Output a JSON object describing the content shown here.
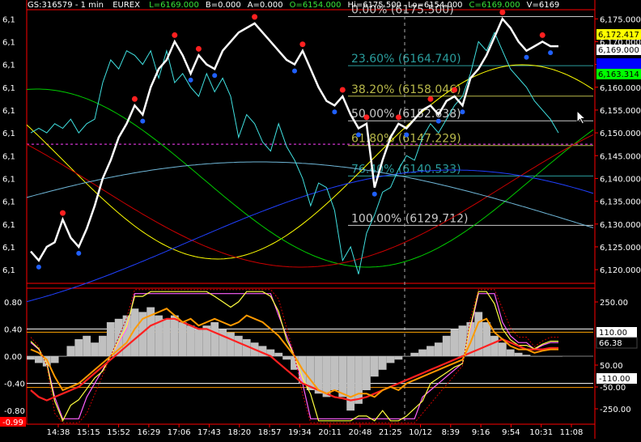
{
  "header": {
    "symbol": "GS:316579 - 1 min",
    "exchange": "EUREX",
    "fields": [
      {
        "text": "L=6169.000",
        "color": "#39e639"
      },
      {
        "text": "B=0.000",
        "color": "#ffffff"
      },
      {
        "text": "A=0.000",
        "color": "#ffffff"
      },
      {
        "text": "O=6154.000",
        "color": "#39e639"
      },
      {
        "text": "Hi=6175.500",
        "color": "#ffffff"
      },
      {
        "text": "Lo=6154.000",
        "color": "#ffffff"
      },
      {
        "text": "C=6169.000",
        "color": "#39e639"
      },
      {
        "text": "V=6169",
        "color": "#ffffff"
      }
    ]
  },
  "price_axis": {
    "ticks": [
      "6,175.000",
      "6,170.000",
      "6,165.000",
      "6,160.000",
      "6,155.000",
      "6,150.000",
      "6,145.000",
      "6,140.000",
      "6,135.000",
      "6,130.000",
      "6,125.000",
      "6,120.000"
    ],
    "left_ticks": [
      "6,1",
      "6,1",
      "6,1",
      "6,1",
      "6,1",
      "6,1",
      "6,1",
      "6,1",
      "6,1",
      "6,1",
      "6,1",
      "6,1"
    ],
    "markers": [
      {
        "text": "6,172.417",
        "bg": "#ffff00",
        "fg": "#000000"
      },
      {
        "text": "6,169.000",
        "bg": "#ffffff",
        "fg": "#000000"
      },
      {
        "text": "6,168.259",
        "bg": "#0000ff",
        "fg": "#0000ff"
      },
      {
        "text": "6,163.314",
        "bg": "#00ff00",
        "fg": "#000000"
      }
    ]
  },
  "osc_axis": {
    "left_ticks": [
      "0.80",
      "0.40",
      "0.00",
      "-0.40",
      "-0.80"
    ],
    "left_bottom_badge": "-0.99",
    "right_ticks": [
      "250.00",
      "50.00",
      "-50.00",
      "-250.00"
    ],
    "markers": [
      {
        "text": "110.00",
        "bg": "#ffffff",
        "fg": "#000000"
      },
      {
        "text": "66.38",
        "bg": "#000000",
        "fg": "#ffffff"
      },
      {
        "text": "-110.00",
        "bg": "#ffffff",
        "fg": "#000000"
      }
    ]
  },
  "time_axis": [
    "14:38",
    "15:15",
    "15:52",
    "16:29",
    "17:06",
    "17:43",
    "18:20",
    "18:57",
    "19:34",
    "20:11",
    "20:48",
    "21:25",
    "10/12",
    "8:39",
    "9:16",
    "9:54",
    "10:31",
    "11:08"
  ],
  "fibonacci": [
    {
      "label": "0.00% (6175.500)",
      "value": 6175.5,
      "color": "#c8c8c8"
    },
    {
      "label": "23.60% (6164.740)",
      "value": 6164.74,
      "color": "#2a9d9d"
    },
    {
      "label": "38.20% (6158.046)",
      "value": 6158.046,
      "color": "#b8b84a"
    },
    {
      "label": "50.00% (6152.638)",
      "value": 6152.638,
      "color": "#c8c8c8"
    },
    {
      "label": "61.80% (6147.229)",
      "value": 6147.229,
      "color": "#b8b84a"
    },
    {
      "label": "76.40% (6140.533)",
      "value": 6140.533,
      "color": "#2a9d9d"
    },
    {
      "label": "100.00% (6129.712)",
      "value": 6129.712,
      "color": "#c8c8c8"
    }
  ],
  "chart_data": {
    "type": "line",
    "price_range": [
      6117,
      6177
    ],
    "osc_range": [
      -1.0,
      1.0
    ],
    "grid": false,
    "price_series": [
      6124,
      6122,
      6125,
      6126,
      6131,
      6127,
      6125,
      6129,
      6134,
      6140,
      6144,
      6149,
      6152,
      6156,
      6154,
      6160,
      6164,
      6166,
      6170,
      6167,
      6163,
      6167,
      6165,
      6164,
      6168,
      6170,
      6172,
      6173,
      6174,
      6172,
      6170,
      6168,
      6166,
      6165,
      6168,
      6164,
      6160,
      6157,
      6156,
      6158,
      6154,
      6151,
      6152,
      6138,
      6144,
      6149,
      6152,
      6151,
      6153,
      6155,
      6156,
      6154,
      6157,
      6158,
      6156,
      6162,
      6164,
      6167,
      6171,
      6175,
      6173,
      6170,
      6168,
      6169,
      6170,
      6169,
      6169
    ],
    "compare_series": [
      6150,
      6151,
      6150,
      6152,
      6151,
      6153,
      6150,
      6152,
      6153,
      6161,
      6166,
      6164,
      6168,
      6167,
      6165,
      6168,
      6162,
      6168,
      6161,
      6163,
      6160,
      6158,
      6163,
      6159,
      6162,
      6158,
      6149,
      6154,
      6152,
      6148,
      6146,
      6152,
      6147,
      6144,
      6140,
      6134,
      6139,
      6138,
      6133,
      6122,
      6125,
      6119,
      6128,
      6132,
      6137,
      6138,
      6142,
      6145,
      6144,
      6149,
      6152,
      6150,
      6153,
      6156,
      6158,
      6163,
      6170,
      6168,
      6172,
      6168,
      6164,
      6162,
      6160,
      6157,
      6155,
      6153,
      6150
    ],
    "osc_series": [
      0.1,
      0.05,
      -0.05,
      -0.3,
      -0.5,
      -0.45,
      -0.4,
      -0.3,
      -0.2,
      -0.1,
      0.0,
      0.1,
      0.2,
      0.4,
      0.55,
      0.6,
      0.65,
      0.7,
      0.6,
      0.5,
      0.55,
      0.45,
      0.5,
      0.55,
      0.5,
      0.45,
      0.5,
      0.6,
      0.55,
      0.5,
      0.4,
      0.3,
      0.15,
      0.0,
      -0.2,
      -0.35,
      -0.5,
      -0.55,
      -0.5,
      -0.55,
      -0.6,
      -0.55,
      -0.55,
      -0.6,
      -0.5,
      -0.45,
      -0.5,
      -0.4,
      -0.35,
      -0.3,
      -0.25,
      -0.2,
      -0.15,
      -0.1,
      -0.05,
      0.2,
      0.5,
      0.55,
      0.35,
      0.25,
      0.15,
      0.1,
      0.1,
      0.05,
      0.08,
      0.1,
      0.1
    ],
    "hist_series": [
      -0.05,
      -0.1,
      -0.15,
      -0.1,
      0.0,
      0.15,
      0.25,
      0.3,
      0.2,
      0.3,
      0.5,
      0.55,
      0.6,
      0.7,
      0.65,
      0.72,
      0.6,
      0.55,
      0.6,
      0.5,
      0.45,
      0.4,
      0.45,
      0.5,
      0.4,
      0.35,
      0.3,
      0.25,
      0.2,
      0.15,
      0.1,
      0.05,
      -0.05,
      -0.2,
      -0.4,
      -0.5,
      -0.55,
      -0.6,
      -0.5,
      -0.6,
      -0.8,
      -0.7,
      -0.5,
      -0.3,
      -0.2,
      -0.1,
      -0.05,
      0.0,
      0.05,
      0.1,
      0.15,
      0.2,
      0.3,
      0.4,
      0.45,
      0.5,
      0.65,
      0.5,
      0.3,
      0.2,
      0.1,
      0.05,
      0.02,
      0.0,
      0.0,
      0.0,
      0.0
    ],
    "trigger_series": [
      -0.5,
      -0.6,
      -0.65,
      -0.6,
      -0.55,
      -0.5,
      -0.45,
      -0.35,
      -0.25,
      -0.15,
      -0.05,
      0.05,
      0.15,
      0.25,
      0.35,
      0.45,
      0.5,
      0.55,
      0.55,
      0.5,
      0.45,
      0.4,
      0.4,
      0.35,
      0.3,
      0.25,
      0.2,
      0.15,
      0.1,
      0.05,
      0.0,
      -0.1,
      -0.2,
      -0.3,
      -0.4,
      -0.45,
      -0.5,
      -0.55,
      -0.6,
      -0.62,
      -0.65,
      -0.63,
      -0.6,
      -0.55,
      -0.5,
      -0.45,
      -0.4,
      -0.35,
      -0.3,
      -0.25,
      -0.2,
      -0.15,
      -0.1,
      -0.05,
      0.0,
      0.05,
      0.1,
      0.15,
      0.2,
      0.25,
      0.2,
      0.15,
      0.1,
      0.1,
      0.1,
      0.12,
      0.12
    ],
    "hlines_osc": [
      0.4,
      0.0,
      -0.4
    ],
    "dotted_price_level": 6147.5
  }
}
